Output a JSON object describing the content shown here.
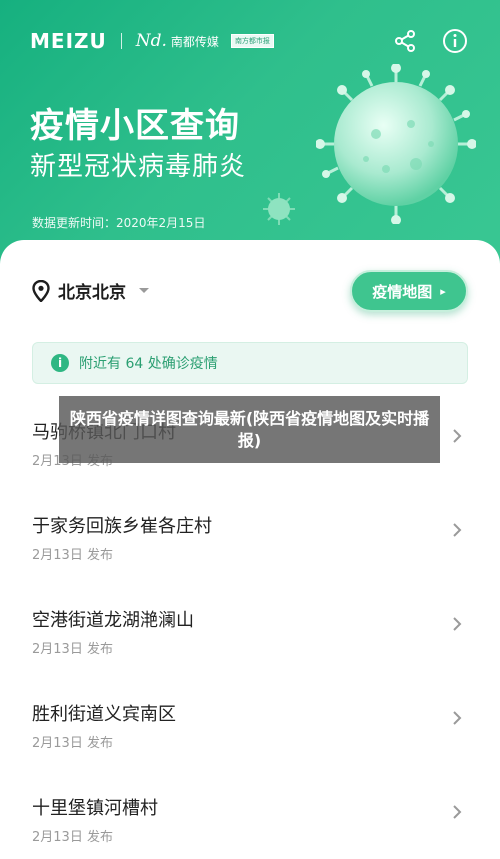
{
  "header": {
    "brand": "MEIZU",
    "partner": "Nd.",
    "partner_name": "南都传媒",
    "partner_paper": "南方都市报",
    "icons": [
      "share-icon",
      "info-circle-icon"
    ]
  },
  "hero": {
    "title": "疫情小区查询",
    "subtitle": "新型冠状病毒肺炎",
    "update_label": "数据更新时间：2020年2月15日",
    "colors": {
      "gradient_start": "#16b07f",
      "gradient_end": "#39c793"
    }
  },
  "location": {
    "text": "北京北京",
    "icon": "location-pin-icon"
  },
  "map_button": {
    "label": "疫情地图",
    "arrow": "▸"
  },
  "notice": {
    "icon": "i",
    "text": "附近有 64 处确诊疫情"
  },
  "list": [
    {
      "name": "马驹桥镇北门口村",
      "date": "2月13日 发布"
    },
    {
      "name": "于家务回族乡崔各庄村",
      "date": "2月13日 发布"
    },
    {
      "name": "空港街道龙湖滟澜山",
      "date": "2月13日 发布"
    },
    {
      "name": "胜利街道义宾南区",
      "date": "2月13日 发布"
    },
    {
      "name": "十里堡镇河槽村",
      "date": "2月13日 发布"
    }
  ],
  "overlay": {
    "caption": "陕西省疫情详图查询最新(陕西省疫情地图及实时播报)"
  }
}
